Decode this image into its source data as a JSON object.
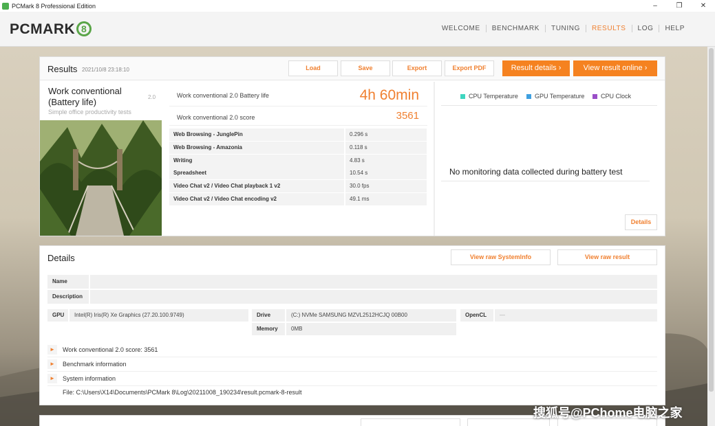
{
  "window": {
    "title": "PCMark 8 Professional Edition",
    "min": "–",
    "max": "❐",
    "close": "✕"
  },
  "header": {
    "logo": "PCMARK",
    "logo_num": "8",
    "nav": [
      {
        "label": "WELCOME",
        "active": false
      },
      {
        "label": "BENCHMARK",
        "active": false
      },
      {
        "label": "TUNING",
        "active": false
      },
      {
        "label": "RESULTS",
        "active": true
      },
      {
        "label": "LOG",
        "active": false
      },
      {
        "label": "HELP",
        "active": false
      }
    ]
  },
  "results": {
    "title": "Results",
    "date": "2021/10/8 23:18:10",
    "buttons": {
      "load": "Load",
      "save": "Save",
      "export": "Export",
      "export_pdf": "Export PDF",
      "result_details": "Result details",
      "view_online": "View result online",
      "chevron": "›"
    },
    "test": {
      "name": "Work conventional (Battery life)",
      "version": "2.0",
      "subtitle": "Simple office productivity tests"
    },
    "battery_label": "Work conventional 2.0 Battery life",
    "battery_value": "4h 60min",
    "score_label": "Work conventional 2.0 score",
    "score_value": "3561",
    "rows": [
      {
        "name": "Web Browsing - JunglePin",
        "value": "0.296 s"
      },
      {
        "name": "Web Browsing - Amazonia",
        "value": "0.118 s"
      },
      {
        "name": "Writing",
        "value": "4.83 s"
      },
      {
        "name": "Spreadsheet",
        "value": "10.54 s"
      },
      {
        "name": "Video Chat v2 / Video Chat playback 1 v2",
        "value": "30.0 fps"
      },
      {
        "name": "Video Chat v2 / Video Chat encoding v2",
        "value": "49.1 ms"
      }
    ],
    "legend": [
      {
        "label": "CPU Temperature",
        "color": "#3fd6c0"
      },
      {
        "label": "GPU Temperature",
        "color": "#3fa0e0"
      },
      {
        "label": "CPU Clock",
        "color": "#9a4fc8"
      }
    ],
    "no_monitoring": "No monitoring data collected during battery test",
    "details_btn": "Details"
  },
  "details": {
    "title": "Details",
    "raw_sysinfo": "View raw SystemInfo",
    "raw_result": "View raw result",
    "name_label": "Name",
    "name_value": "",
    "desc_label": "Description",
    "desc_value": "",
    "gpu_label": "GPU",
    "gpu_value": "Intel(R) Iris(R) Xe Graphics (27.20.100.9749)",
    "drive_label": "Drive",
    "drive_value": "(C:) NVMe SAMSUNG MZVL2512HCJQ 00B00",
    "memory_label": "Memory",
    "memory_value": "0MB",
    "opencl_label": "OpenCL",
    "opencl_value": "—",
    "expanders": [
      "Work conventional 2.0 score: 3561",
      "Benchmark information",
      "System information"
    ],
    "file": "File: C:\\Users\\X14\\Documents\\PCMark 8\\Log\\20211008_190234\\result.pcmark-8-result"
  },
  "watermark": "搜狐号@PChome电脑之家",
  "colors": {
    "accent": "#f08030",
    "orange_button": "#f58220"
  }
}
